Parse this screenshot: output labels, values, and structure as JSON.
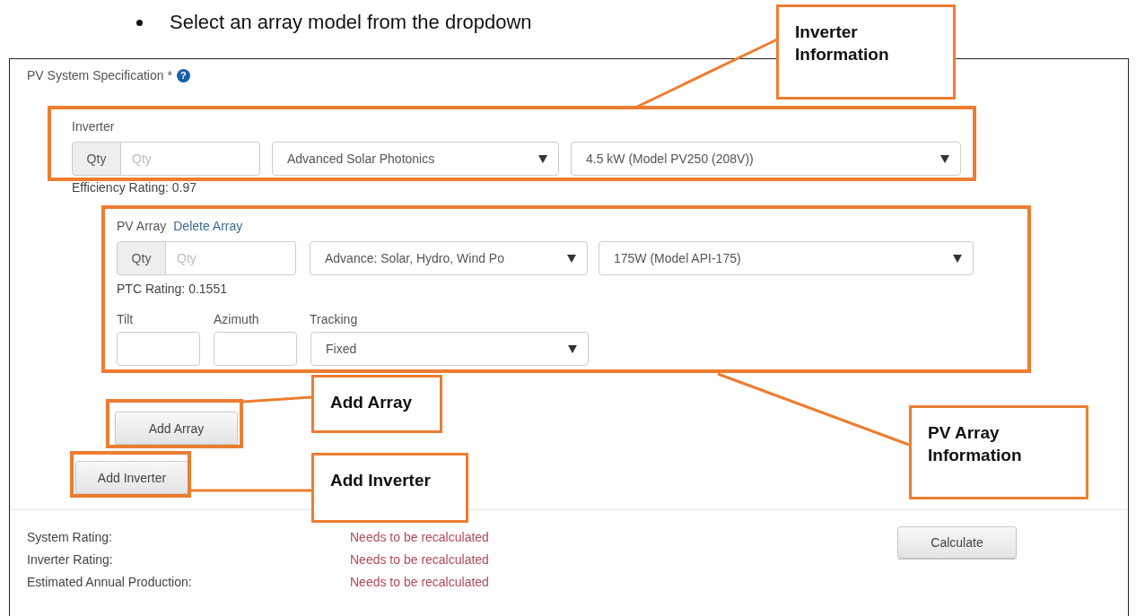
{
  "bullet": "Select an array model from the dropdown",
  "form": {
    "title": "PV System Specification *",
    "help_icon": "?",
    "inverter": {
      "label": "Inverter",
      "qty_addon": "Qty",
      "qty_placeholder": "Qty",
      "manufacturer": "Advanced Solar Photonics",
      "model": "4.5 kW (Model PV250 (208V))",
      "rating": "Efficiency Rating: 0.97"
    },
    "array": {
      "label": "PV Array",
      "delete_link": "Delete Array",
      "qty_addon": "Qty",
      "qty_placeholder": "Qty",
      "manufacturer": "Advance: Solar, Hydro, Wind Po",
      "model": "175W (Model API-175)",
      "rating": "PTC Rating: 0.1551",
      "tilt_label": "Tilt",
      "azimuth_label": "Azimuth",
      "tracking_label": "Tracking",
      "tracking": "Fixed"
    },
    "add_array_button": "Add Array",
    "add_inverter_button": "Add Inverter",
    "results": [
      {
        "label": "System Rating:",
        "value": "Needs to be recalculated"
      },
      {
        "label": "Inverter Rating:",
        "value": "Needs to be recalculated"
      },
      {
        "label": "Estimated Annual Production:",
        "value": "Needs to be recalculated"
      }
    ],
    "calculate_button": "Calculate"
  },
  "callouts": [
    {
      "text": "Inverter Information"
    },
    {
      "text": "Add Array"
    },
    {
      "text": "Add Inverter"
    },
    {
      "text": "PV Array Information"
    }
  ]
}
